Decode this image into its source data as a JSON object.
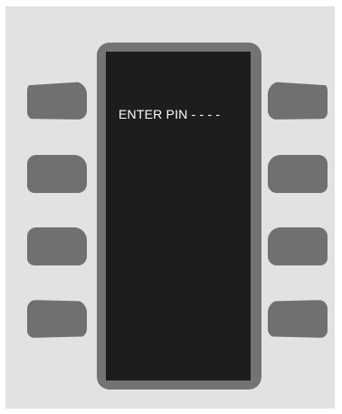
{
  "screen": {
    "prompt_label": "ENTER PIN",
    "pin_mask": "- - - -"
  },
  "softkeys": {
    "left": [
      "",
      "",
      "",
      ""
    ],
    "right": [
      "",
      "",
      "",
      ""
    ]
  },
  "colors": {
    "panel_bg": "#e2e2e2",
    "bezel": "#727374",
    "screen_bg": "#1d1d1d",
    "screen_text": "#ffffff",
    "key": "#6f7070"
  }
}
